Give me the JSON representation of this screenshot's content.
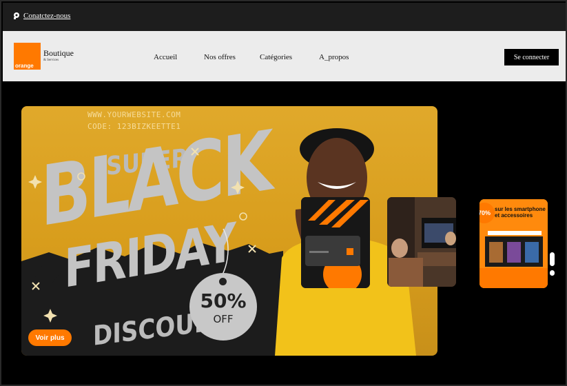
{
  "topbar": {
    "contact_label": "Conatctez-nous",
    "contact_icon": "headset-icon"
  },
  "header": {
    "logo_text": "orange",
    "brand_title": "Boutique",
    "brand_subtitle": "& Services",
    "nav": [
      {
        "label": "Accueil"
      },
      {
        "label": "Nos offres"
      },
      {
        "label": "Catégories"
      },
      {
        "label": "A_propos"
      }
    ],
    "login_label": "Se connecter"
  },
  "hero": {
    "website": "WWW.YOURWEBSITE.COM",
    "code": "CODE: 123BIZKEETTE1",
    "super": "SUPER",
    "black": "BLACK",
    "friday": "FRIDAY",
    "discount": "DISCOUNT",
    "tag_percent": "50%",
    "tag_off": "OFF",
    "cta_label": "Voir plus"
  },
  "carousel": {
    "promo_text": "sur les smartphone et accessoires",
    "promo_badge": "70%"
  },
  "colors": {
    "brand": "#ff7900",
    "banner_yellow": "#d89d1c"
  }
}
